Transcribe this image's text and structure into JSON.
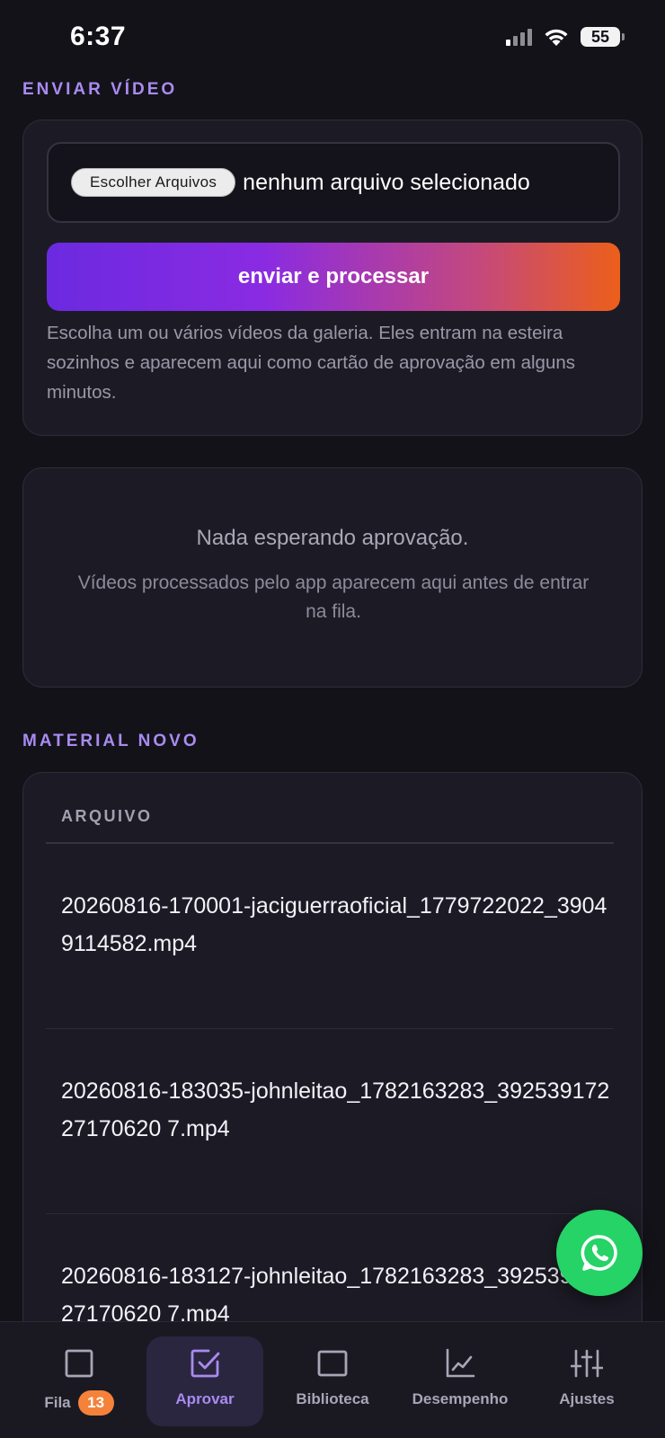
{
  "status_bar": {
    "time": "6:37",
    "battery": "55"
  },
  "upload": {
    "section_label": "ENVIAR VÍDEO",
    "file_button": "Escolher Arquivos",
    "file_status": "nenhum arquivo selecionado",
    "submit_label": "enviar e processar",
    "help_text": "Escolha um ou vários vídeos da galeria. Eles entram na esteira sozinhos e aparecem aqui como cartão de aprovação em alguns minutos."
  },
  "approval_empty": {
    "title": "Nada esperando aprovação.",
    "subtitle": "Vídeos processados pelo app aparecem aqui antes de entrar na fila."
  },
  "material": {
    "section_label": "MATERIAL NOVO",
    "column_header": "ARQUIVO",
    "files": [
      "20260816-170001-jaciguerraoficial_1779722022_39049114582.mp4",
      "20260816-183035-johnleitao_1782163283_39253917227170620 7.mp4",
      "20260816-183127-johnleitao_1782163283_39253917227170620 7.mp4"
    ]
  },
  "nav": {
    "items": [
      {
        "label": "Fila",
        "badge": "13",
        "icon": "square-icon"
      },
      {
        "label": "Aprovar",
        "icon": "check-square-icon"
      },
      {
        "label": "Biblioteca",
        "icon": "library-icon"
      },
      {
        "label": "Desempenho",
        "icon": "chart-icon"
      },
      {
        "label": "Ajustes",
        "icon": "sliders-icon"
      }
    ],
    "active_index": 1
  },
  "colors": {
    "accent": "#a98bf0",
    "badge": "#f5823a",
    "whatsapp": "#25d366",
    "background": "#131219"
  }
}
